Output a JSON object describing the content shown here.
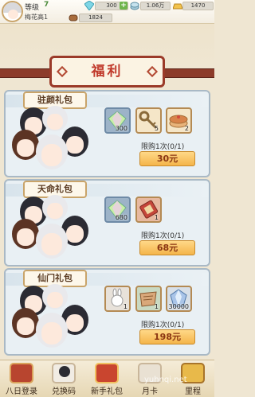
{
  "player": {
    "level_label": "等级",
    "level": "7",
    "name": "梅花高1"
  },
  "resources": [
    {
      "icon": "gem-icon",
      "value": "300"
    },
    {
      "icon": "coin-stack-icon",
      "value": "1.06万"
    },
    {
      "icon": "gold-bar-icon",
      "value": "1470"
    },
    {
      "icon": "wood-icon",
      "value": "1824"
    }
  ],
  "banner": {
    "title": "福利"
  },
  "packs": [
    {
      "name": "驻颜礼包",
      "items": [
        {
          "icon": "rainbow-gem-icon",
          "qty": "300"
        },
        {
          "icon": "key-icon",
          "qty": "5"
        },
        {
          "icon": "cake-icon",
          "qty": "2"
        }
      ],
      "limit": "限购1次(0/1)",
      "price": "30元"
    },
    {
      "name": "天命礼包",
      "items": [
        {
          "icon": "rainbow-gem-icon",
          "qty": "680"
        },
        {
          "icon": "scroll-icon",
          "qty": "1"
        }
      ],
      "limit": "限购1次(0/1)",
      "price": "68元"
    },
    {
      "name": "仙门礼包",
      "items": [
        {
          "icon": "rabbit-charm-icon",
          "qty": "1"
        },
        {
          "icon": "cloth-scroll-icon",
          "qty": "1"
        },
        {
          "icon": "blue-crystal-icon",
          "qty": "30000"
        }
      ],
      "limit": "限购1次(0/1)",
      "price": "198元"
    }
  ],
  "nav": [
    {
      "label": "八日登录",
      "icon": "calendar-icon"
    },
    {
      "label": "兑换码",
      "icon": "exchange-character-icon"
    },
    {
      "label": "新手礼包",
      "icon": "gift-chest-icon"
    },
    {
      "label": "月卡",
      "icon": "month-card-icon"
    },
    {
      "label": "里程",
      "icon": "milestone-icon"
    }
  ],
  "watermark": "yuhnqi.net",
  "colors": {
    "price_button": "#f4b54a",
    "banner_red": "#9b3a29",
    "panel_bg": "#e9f0f4"
  }
}
